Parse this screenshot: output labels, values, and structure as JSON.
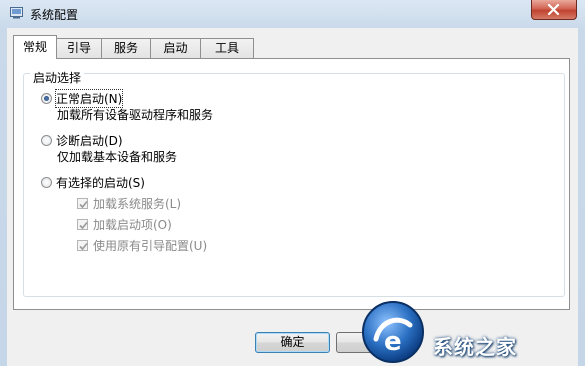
{
  "window": {
    "title": "系统配置"
  },
  "tabs": [
    {
      "label": "常规",
      "active": true
    },
    {
      "label": "引导",
      "active": false
    },
    {
      "label": "服务",
      "active": false
    },
    {
      "label": "启动",
      "active": false
    },
    {
      "label": "工具",
      "active": false
    }
  ],
  "startup": {
    "group_label": "启动选择",
    "options": [
      {
        "label": "正常启动(N)",
        "description": "加载所有设备驱动程序和服务",
        "selected": true
      },
      {
        "label": "诊断启动(D)",
        "description": "仅加载基本设备和服务",
        "selected": false
      },
      {
        "label": "有选择的启动(S)",
        "selected": false
      }
    ],
    "selective_items": [
      {
        "label": "加载系统服务(L)",
        "checked": true,
        "enabled": false
      },
      {
        "label": "加载启动项(O)",
        "checked": true,
        "enabled": false
      },
      {
        "label": "使用原有引导配置(U)",
        "checked": true,
        "enabled": false
      }
    ]
  },
  "buttons": {
    "ok": "确定"
  },
  "watermark": {
    "text": "系统之家"
  },
  "colors": {
    "accent": "#3c7fb1",
    "disabled_text": "#8a8a8a",
    "close_button": "#c0432f"
  }
}
